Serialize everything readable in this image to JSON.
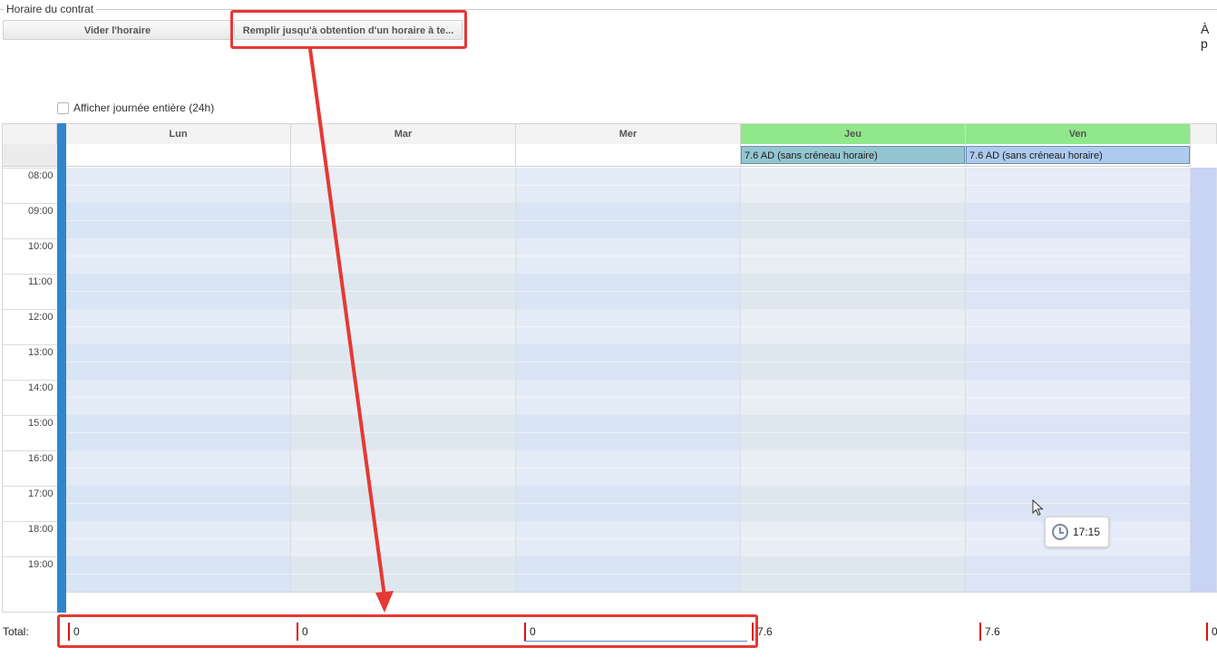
{
  "section": {
    "legend": "Horaire du contrat"
  },
  "toolbar": {
    "clear_label": "Vider l'horaire",
    "fill_label": "Remplir jusqu'à obtention d'un horaire à te...",
    "top_right_text": "À p"
  },
  "options": {
    "show_full_day_label": "Afficher journée entière (24h)",
    "show_full_day_checked": false
  },
  "calendar": {
    "days": [
      {
        "label": "Lun",
        "highlighted": false,
        "event": ""
      },
      {
        "label": "Mar",
        "highlighted": false,
        "event": ""
      },
      {
        "label": "Mer",
        "highlighted": false,
        "event": ""
      },
      {
        "label": "Jeu",
        "highlighted": true,
        "event": "7.6 AD (sans créneau horaire)"
      },
      {
        "label": "Ven",
        "highlighted": true,
        "event": "7.6 AD (sans créneau horaire)"
      }
    ],
    "hours": [
      "08:00",
      "09:00",
      "10:00",
      "11:00",
      "12:00",
      "13:00",
      "14:00",
      "15:00",
      "16:00",
      "17:00",
      "18:00",
      "19:00"
    ],
    "tooltip_time": "17:15"
  },
  "totals": {
    "label": "Total:",
    "values": [
      "0",
      "0",
      "0",
      "7.6",
      "7.6",
      "0"
    ]
  },
  "colors": {
    "highlight_red": "#e53935",
    "left_bar_blue": "#2f86cf",
    "weekend_header_green": "#90e88a",
    "event_jeu": "#93c6d0",
    "event_ven": "#aecbee"
  }
}
